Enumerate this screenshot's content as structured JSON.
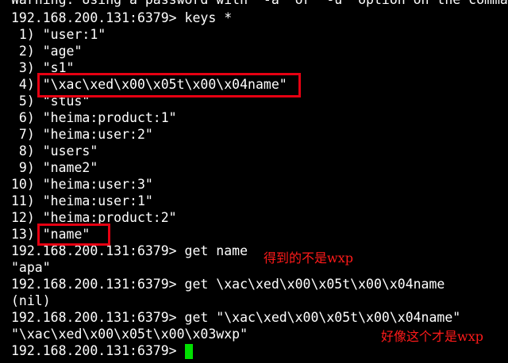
{
  "terminal": {
    "lines": [
      "Warning: Using a password with '-a' or '-u' option on the comma",
      "192.168.200.131:6379> keys *",
      " 1) \"user:1\"",
      " 2) \"age\"",
      " 3) \"s1\"",
      " 4) \"\\xac\\xed\\x00\\x05t\\x00\\x04name\"",
      " 5) \"stus\"",
      " 6) \"heima:product:1\"",
      " 7) \"heima:user:2\"",
      " 8) \"users\"",
      " 9) \"name2\"",
      "10) \"heima:user:3\"",
      "11) \"heima:user:1\"",
      "12) \"heima:product:2\"",
      "13) \"name\"",
      "192.168.200.131:6379> get name",
      "\"apa\"",
      "192.168.200.131:6379> get \\xac\\xed\\x00\\x05t\\x00\\x04name",
      "(nil)",
      "192.168.200.131:6379> get \"\\xac\\xed\\x00\\x05t\\x00\\x04name\"",
      "\"\\xac\\xed\\x00\\x05t\\x00\\x03wxp\"",
      "192.168.200.131:6379> "
    ]
  },
  "annotations": {
    "note_1": "得到的不是wxp",
    "note_2": "好像这个才是wxp"
  },
  "colors": {
    "background": "#000000",
    "text": "#ffffff",
    "highlight_box": "#e60012",
    "annotation_text": "#ff1a1a",
    "cursor": "#00e000"
  }
}
